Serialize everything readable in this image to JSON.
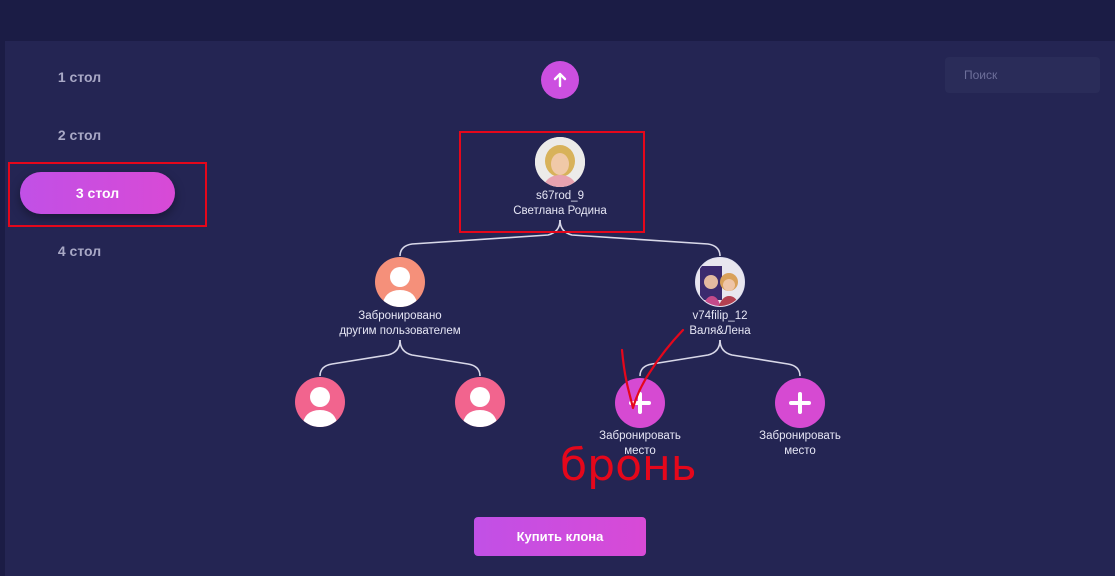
{
  "sidebar": {
    "items": [
      {
        "label": "1 стол",
        "active": false
      },
      {
        "label": "2 стол",
        "active": false
      },
      {
        "label": "3 стол",
        "active": true
      },
      {
        "label": "4 стол",
        "active": false
      }
    ]
  },
  "search": {
    "placeholder": "Поиск"
  },
  "tree": {
    "root": {
      "login": "s67rod_9",
      "name": "Светлана Родина"
    },
    "left": {
      "line1": "Забронировано",
      "line2": "другим пользователем"
    },
    "right": {
      "login": "v74filip_12",
      "name": "Валя&Лена"
    },
    "slots": [
      {
        "line1": "Забронировать",
        "line2": "место"
      },
      {
        "line1": "Забронировать",
        "line2": "место"
      }
    ]
  },
  "buy_button": {
    "label": "Купить клона"
  },
  "annotation": {
    "text": "бронь"
  },
  "colors": {
    "accent": "#cc4fe0",
    "annotation": "#e5071b",
    "booked_avatar": "#f5907a",
    "empty_avatar": "#f2648e"
  }
}
